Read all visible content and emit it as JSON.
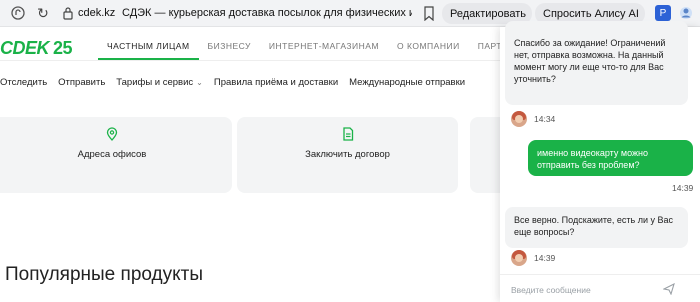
{
  "browser": {
    "domain": "cdek.kz",
    "tab_title": "СДЭК — курьерская доставка посылок для физических и юрид...",
    "edit_label": "Редактировать",
    "alice_label": "Спросить Алису AI",
    "ext_label": "P"
  },
  "site": {
    "logo_text": "СDEK",
    "logo_badge": "25",
    "brand_color": "#1ab248",
    "topnav": [
      "ЧАСТНЫМ ЛИЦАМ",
      "БИЗНЕСУ",
      "ИНТЕРНЕТ-МАГАЗИНАМ",
      "О КОМПАНИИ",
      "ПАРТНЕРСКАЯ СЕТЬ"
    ],
    "subnav": [
      "Отследить",
      "Отправить",
      "Тарифы и сервис",
      "Правила приёма и доставки",
      "Международные отправки"
    ],
    "cards": [
      "Адреса офисов",
      "Заключить договор"
    ],
    "popular_heading": "Популярные продукты"
  },
  "chat": {
    "messages": [
      {
        "from": "bot",
        "text": "Спасибо за ожидание! Ограничений нет, отправка возможна. На данный момент могу ли еще что-то для Вас уточнить?",
        "time": "14:34"
      },
      {
        "from": "user",
        "text": "именно видеокарту можно отправить без проблем?",
        "time": "14:39"
      },
      {
        "from": "bot",
        "text": "Все верно. Подскажите, есть ли у Вас еще вопросы?",
        "time": "14:39"
      }
    ],
    "input_placeholder": "Введите сообщение"
  }
}
